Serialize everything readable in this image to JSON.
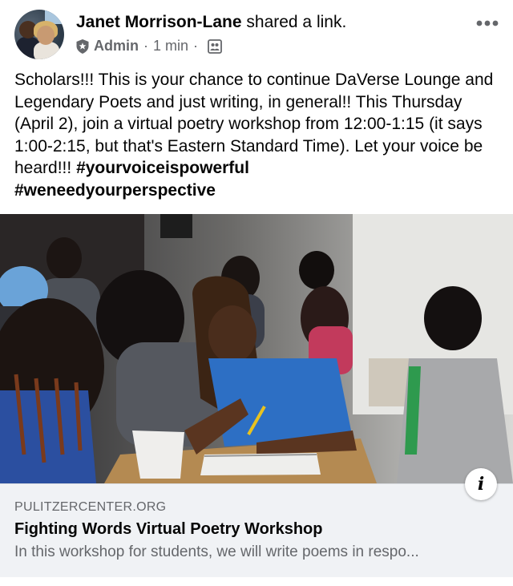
{
  "post": {
    "author_name": "Janet Morrison-Lane",
    "action_text": "shared a link.",
    "role": "Admin",
    "separator": "·",
    "timestamp": "1 min",
    "message_text": "Scholars!!! This is your chance to continue DaVerse Lounge and Legendary Poets and just writing, in general!! This Thursday (April 2), join a virtual poetry workshop from 12:00-1:15 (it says 1:00-2:15, but that's Eastern Standard Time). Let your voice be heard!!! ",
    "hashtags": [
      "#yourvoiceispowerful",
      "#weneedyourperspective"
    ]
  },
  "icons": {
    "role_icon": "shield-star-icon",
    "audience_icon": "group-audience-icon",
    "more_icon": "more-horizontal-icon",
    "info_icon": "info-icon"
  },
  "link_preview": {
    "domain": "PULITZERCENTER.ORG",
    "title": "Fighting Words Virtual Poetry Workshop",
    "description": "In this workshop for students, we will write poems in respo..."
  },
  "info_glyph": "i",
  "colors": {
    "text_primary": "#050505",
    "text_secondary": "#65676b",
    "preview_bg": "#f0f2f5"
  }
}
